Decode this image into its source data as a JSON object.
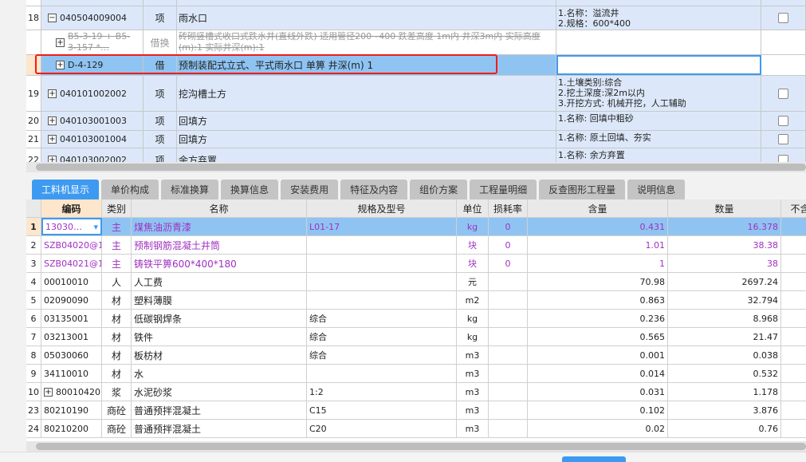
{
  "top_rows": [
    {
      "num": "18",
      "code": "040504009004",
      "expander": "−",
      "type": "项",
      "name": "雨水口",
      "features": "1.名称：溢流井\n2.规格：600*400",
      "checkbox": true
    },
    {
      "num": "",
      "code": "B5-3-19 + B5-3-157 *…",
      "expander": "+",
      "type": "借换",
      "name": "砖砌竖槽式收口式跌水井(直线外跌) 适用管径200~400 跌差高度 1m内 井深3m内  实际高度(m):1  实际井深(m):1",
      "features": "",
      "checkbox": false,
      "struck": true
    },
    {
      "num": "",
      "code": "D-4-129",
      "expander": "+",
      "type": "借",
      "name": "预制装配式立式、平式雨水口 单箅 井深(m) 1",
      "features": "",
      "checkbox": false,
      "selected": true
    },
    {
      "num": "19",
      "code": "040101002002",
      "expander": "+",
      "type": "项",
      "name": "挖沟槽土方",
      "features": "1.土壤类别:综合\n2.挖土深度:深2m以内\n3.开挖方式: 机械开挖，人工辅助",
      "checkbox": true
    },
    {
      "num": "20",
      "code": "040103001003",
      "expander": "+",
      "type": "项",
      "name": "回填方",
      "features": "1.名称: 回填中粗砂",
      "checkbox": true
    },
    {
      "num": "21",
      "code": "040103001004",
      "expander": "+",
      "type": "项",
      "name": "回填方",
      "features": "1.名称: 原土回填、夯实",
      "checkbox": true
    },
    {
      "num": "22",
      "code": "040103002002",
      "expander": "+",
      "type": "项",
      "name": "余方弃置",
      "features": "1.名称: 余方弃置",
      "checkbox": true
    }
  ],
  "tabs": [
    "工料机显示",
    "单价构成",
    "标准换算",
    "换算信息",
    "安装费用",
    "特征及内容",
    "组价方案",
    "工程量明细",
    "反查图形工程量",
    "说明信息"
  ],
  "headers": [
    "编码",
    "类别",
    "名称",
    "规格及型号",
    "单位",
    "损耗率",
    "含量",
    "数量",
    "不含税"
  ],
  "rows": [
    {
      "n": "1",
      "code": "13030…",
      "type": "主",
      "name": "煤焦油沥青漆",
      "spec": "L01-17",
      "unit": "kg",
      "loss": "0",
      "content": "0.431",
      "qty": "16.378",
      "main": true
    },
    {
      "n": "2",
      "code": "SZB04020@1",
      "type": "主",
      "name": "预制钢筋混凝土井筒",
      "spec": "",
      "unit": "块",
      "loss": "0",
      "content": "1.01",
      "qty": "38.38",
      "main": true
    },
    {
      "n": "3",
      "code": "SZB04021@1",
      "type": "主",
      "name": "铸铁平箅600*400*180",
      "spec": "",
      "unit": "块",
      "loss": "0",
      "content": "1",
      "qty": "38",
      "main": true
    },
    {
      "n": "4",
      "code": "00010010",
      "type": "人",
      "name": "人工费",
      "spec": "",
      "unit": "元",
      "loss": "",
      "content": "70.98",
      "qty": "2697.24"
    },
    {
      "n": "5",
      "code": "02090090",
      "type": "材",
      "name": "塑料薄膜",
      "spec": "",
      "unit": "m2",
      "loss": "",
      "content": "0.863",
      "qty": "32.794"
    },
    {
      "n": "6",
      "code": "03135001",
      "type": "材",
      "name": "低碳钢焊条",
      "spec": "综合",
      "unit": "kg",
      "loss": "",
      "content": "0.236",
      "qty": "8.968"
    },
    {
      "n": "7",
      "code": "03213001",
      "type": "材",
      "name": "铁件",
      "spec": "综合",
      "unit": "kg",
      "loss": "",
      "content": "0.565",
      "qty": "21.47"
    },
    {
      "n": "8",
      "code": "05030060",
      "type": "材",
      "name": "板枋材",
      "spec": "综合",
      "unit": "m3",
      "loss": "",
      "content": "0.001",
      "qty": "0.038"
    },
    {
      "n": "9",
      "code": "34110010",
      "type": "材",
      "name": "水",
      "spec": "",
      "unit": "m3",
      "loss": "",
      "content": "0.014",
      "qty": "0.532"
    },
    {
      "n": "10",
      "code": "80010420",
      "type": "浆",
      "name": "水泥砂浆",
      "spec": "1:2",
      "unit": "m3",
      "loss": "",
      "content": "0.031",
      "qty": "1.178",
      "expander": "+"
    },
    {
      "n": "23",
      "code": "80210190",
      "type": "商砼",
      "name": "普通预拌混凝土",
      "spec": "C15",
      "unit": "m3",
      "loss": "",
      "content": "0.102",
      "qty": "3.876"
    },
    {
      "n": "24",
      "code": "80210200",
      "type": "商砼",
      "name": "普通预拌混凝土",
      "spec": "C20",
      "unit": "m3",
      "loss": "",
      "content": "0.02",
      "qty": "0.76"
    }
  ]
}
